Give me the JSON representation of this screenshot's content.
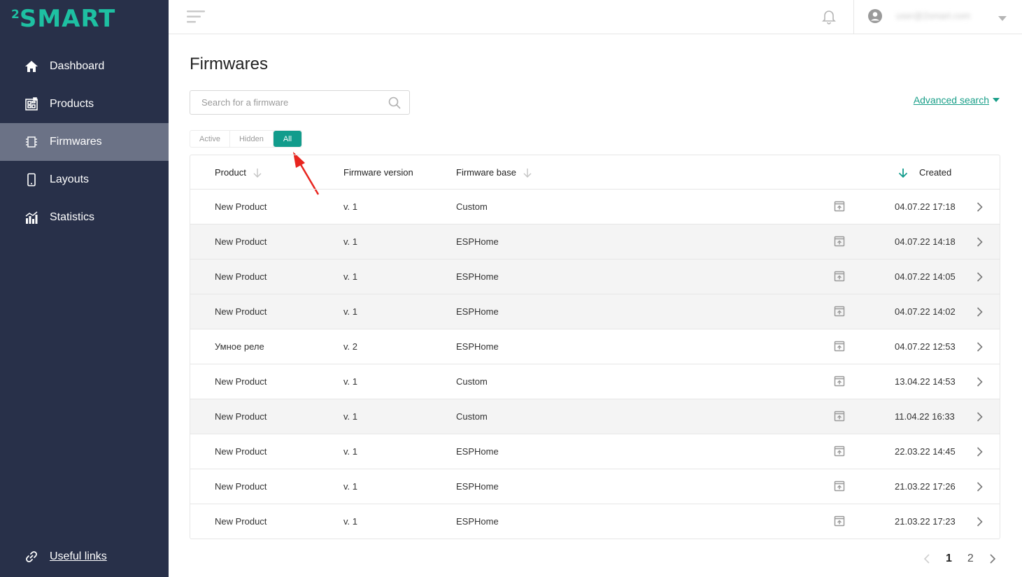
{
  "brand": {
    "prefix": "2",
    "name": "SMART",
    "color": "#1ec0a2"
  },
  "sidebar": {
    "items": [
      {
        "label": "Dashboard",
        "icon": "home-icon",
        "active": false
      },
      {
        "label": "Products",
        "icon": "products-icon",
        "active": false
      },
      {
        "label": "Firmwares",
        "icon": "chip-icon",
        "active": true
      },
      {
        "label": "Layouts",
        "icon": "phone-icon",
        "active": false
      },
      {
        "label": "Statistics",
        "icon": "bar-chart-icon",
        "active": false
      }
    ],
    "footer_link": {
      "label": "Useful links",
      "icon": "link-icon"
    }
  },
  "header": {
    "user_email": "user@2smart.com",
    "icons": [
      "menu-toggle-icon",
      "bell-icon",
      "user-avatar-icon",
      "chevron-down-icon"
    ]
  },
  "main": {
    "title": "Firmwares",
    "search": {
      "placeholder": "Search for a firmware",
      "value": ""
    },
    "advanced_search_label": "Advanced search",
    "filter": {
      "options": [
        "Active",
        "Hidden",
        "All"
      ],
      "selected": "All"
    },
    "table": {
      "columns": [
        "Product",
        "Firmware version",
        "Firmware base",
        "Created"
      ],
      "rows": [
        {
          "product": "New Product",
          "version": "v. 1",
          "base": "Custom",
          "created": "04.07.22 17:18"
        },
        {
          "product": "New Product",
          "version": "v. 1",
          "base": "ESPHome",
          "created": "04.07.22 14:18"
        },
        {
          "product": "New Product",
          "version": "v. 1",
          "base": "ESPHome",
          "created": "04.07.22 14:05"
        },
        {
          "product": "New Product",
          "version": "v. 1",
          "base": "ESPHome",
          "created": "04.07.22 14:02"
        },
        {
          "product": "Умное реле",
          "version": "v. 2",
          "base": "ESPHome",
          "created": "04.07.22 12:53"
        },
        {
          "product": "New Product",
          "version": "v. 1",
          "base": "Custom",
          "created": "13.04.22 14:53"
        },
        {
          "product": "New Product",
          "version": "v. 1",
          "base": "Custom",
          "created": "11.04.22 16:33"
        },
        {
          "product": "New Product",
          "version": "v. 1",
          "base": "ESPHome",
          "created": "22.03.22 14:45"
        },
        {
          "product": "New Product",
          "version": "v. 1",
          "base": "ESPHome",
          "created": "21.03.22 17:26"
        },
        {
          "product": "New Product",
          "version": "v. 1",
          "base": "ESPHome",
          "created": "21.03.22 17:23"
        }
      ]
    },
    "pagination": {
      "pages": [
        "1",
        "2"
      ],
      "current": "1"
    }
  },
  "colors": {
    "sidebar_bg": "#283049",
    "sidebar_active": "#6b7286",
    "accent": "#129c8c",
    "annotation": "#e8251f"
  }
}
